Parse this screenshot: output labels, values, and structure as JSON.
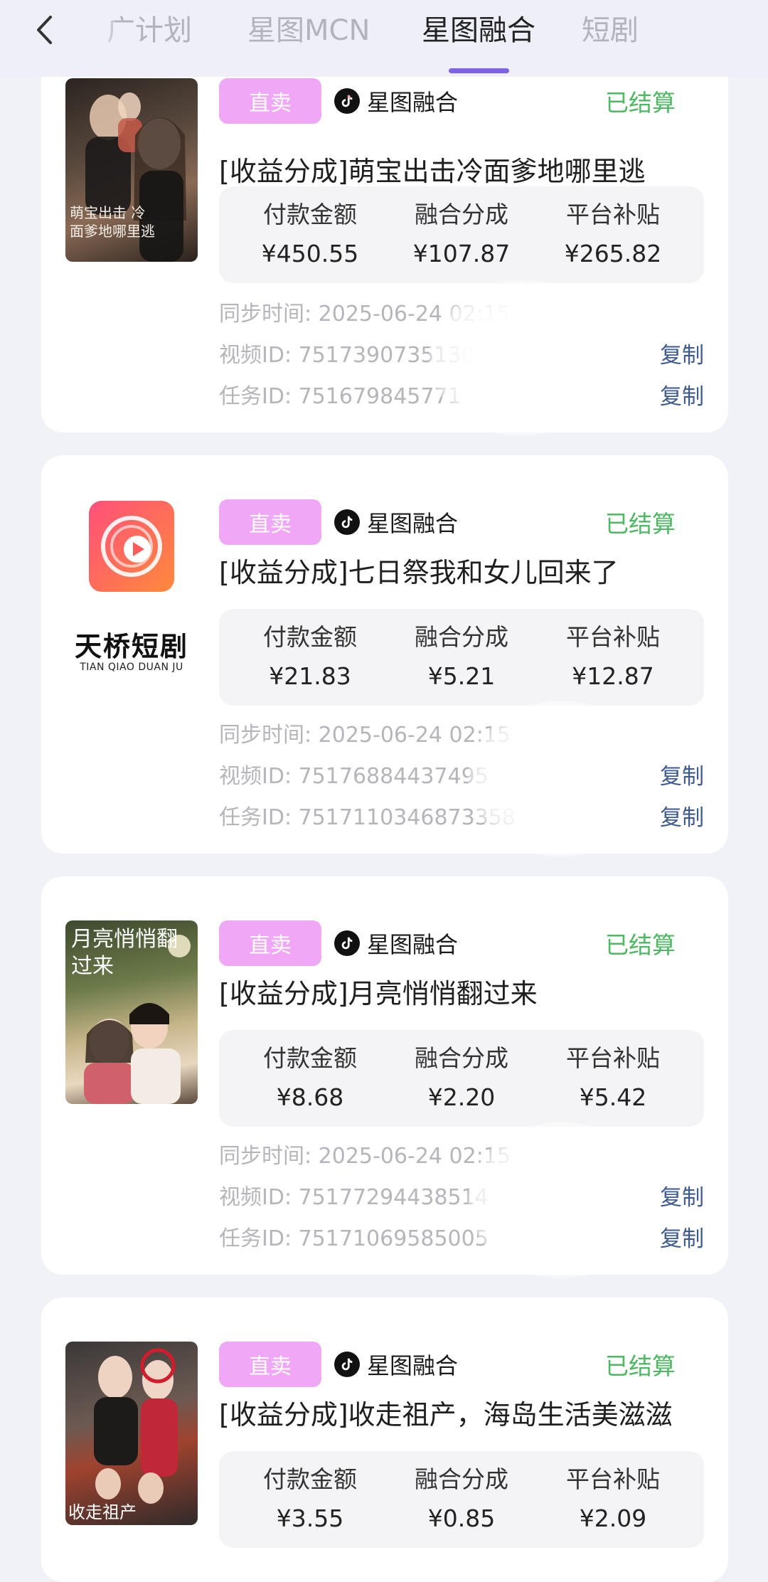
{
  "nav": {
    "back_label": "<",
    "tabs": [
      {
        "label": "广计划",
        "active": false
      },
      {
        "label": "星图MCN",
        "active": false
      },
      {
        "label": "星图融合",
        "active": true
      },
      {
        "label": "短剧",
        "active": false
      }
    ]
  },
  "colors": {
    "accent": "#7f63e6",
    "badge": "#f0a8f6",
    "status_green": "#4fb862",
    "copy_link": "#3f5a8c"
  },
  "cards": [
    {
      "badge": "直卖",
      "platform": "星图融合",
      "platform_icon": "tiktok-icon",
      "status": "已结算",
      "title": "[收益分成]萌宝出击冷面爹地哪里逃",
      "thumb_icon": "drama-poster-image",
      "thumb_caption": "萌宝出击 冷面爹地哪里逃",
      "stats": [
        {
          "label": "付款金额",
          "value": "¥450.55"
        },
        {
          "label": "融合分成",
          "value": "¥107.87"
        },
        {
          "label": "平台补贴",
          "value": "¥265.82"
        }
      ],
      "sync_time": "同步时间: 2025-06-24 02:15",
      "video_id": "视频ID: 7517390735130",
      "task_id": "任务ID: 751679845771",
      "copy_label": "复制"
    },
    {
      "badge": "直卖",
      "platform": "星图融合",
      "platform_icon": "tiktok-icon",
      "status": "已结算",
      "title": "[收益分成]七日祭我和女儿回来了",
      "thumb_icon": "tianqiao-logo",
      "thumb_caption": "天桥短剧",
      "thumb_caption_en": "TIAN QIAO DUAN JU",
      "stats": [
        {
          "label": "付款金额",
          "value": "¥21.83"
        },
        {
          "label": "融合分成",
          "value": "¥5.21"
        },
        {
          "label": "平台补贴",
          "value": "¥12.87"
        }
      ],
      "sync_time": "同步时间: 2025-06-24 02:15",
      "video_id": "视频ID: 75176884437495",
      "task_id": "任务ID: 7517110346873358",
      "copy_label": "复制"
    },
    {
      "badge": "直卖",
      "platform": "星图融合",
      "platform_icon": "tiktok-icon",
      "status": "已结算",
      "title": "[收益分成]月亮悄悄翻过来",
      "thumb_icon": "drama-poster-image",
      "thumb_caption": "月亮悄悄翻过来",
      "stats": [
        {
          "label": "付款金额",
          "value": "¥8.68"
        },
        {
          "label": "融合分成",
          "value": "¥2.20"
        },
        {
          "label": "平台补贴",
          "value": "¥5.42"
        }
      ],
      "sync_time": "同步时间: 2025-06-24 02:15",
      "video_id": "视频ID: 75177294438514",
      "task_id": "任务ID: 75171069585005",
      "copy_label": "复制"
    },
    {
      "badge": "直卖",
      "platform": "星图融合",
      "platform_icon": "tiktok-icon",
      "status": "已结算",
      "title": "[收益分成]收走祖产，海岛生活美滋滋",
      "thumb_icon": "drama-poster-image",
      "thumb_caption": "收走祖产",
      "stats": [
        {
          "label": "付款金额",
          "value": "¥3.55"
        },
        {
          "label": "融合分成",
          "value": "¥0.85"
        },
        {
          "label": "平台补贴",
          "value": "¥2.09"
        }
      ]
    }
  ]
}
